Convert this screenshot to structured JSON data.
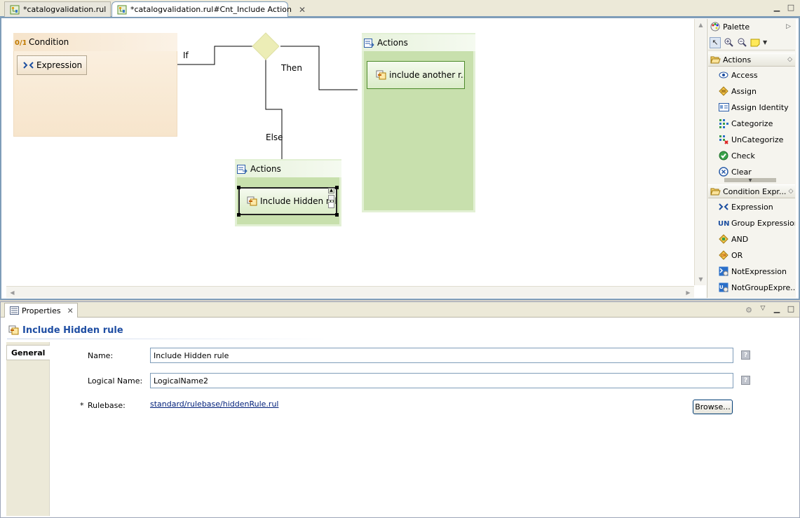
{
  "editor_tabs": [
    {
      "label": "*catalogvalidation.rul",
      "active": false
    },
    {
      "label": "*catalogvalidation.rul#Cnt_Include Action",
      "active": true
    }
  ],
  "diagram": {
    "condition": {
      "title": "Condition",
      "expression_label": "Expression"
    },
    "connector_labels": {
      "if": "If",
      "then": "Then",
      "else": "Else"
    },
    "actions_then": {
      "title": "Actions",
      "item_label": "include another r..."
    },
    "actions_else": {
      "title": "Actions",
      "item_label": "Include Hidden rul"
    }
  },
  "palette": {
    "title": "Palette",
    "drawers": [
      {
        "label": "Actions",
        "items": [
          {
            "label": "Access",
            "icon": "eye-icon"
          },
          {
            "label": "Assign",
            "icon": "assign-icon"
          },
          {
            "label": "Assign Identity",
            "icon": "identity-card-icon"
          },
          {
            "label": "Categorize",
            "icon": "categorize-grid-icon"
          },
          {
            "label": "UnCategorize",
            "icon": "uncategorize-grid-icon"
          },
          {
            "label": "Check",
            "icon": "check-icon"
          },
          {
            "label": "Clear",
            "icon": "clear-icon"
          }
        ]
      },
      {
        "label": "Condition Expr...",
        "items": [
          {
            "label": "Expression",
            "icon": "expression-icon"
          },
          {
            "label": "Group Expression",
            "icon": "group-expression-icon"
          },
          {
            "label": "AND",
            "icon": "and-icon"
          },
          {
            "label": "OR",
            "icon": "or-icon"
          },
          {
            "label": "NotExpression",
            "icon": "not-expression-icon"
          },
          {
            "label": "NotGroupExpre...",
            "icon": "not-group-expression-icon"
          }
        ]
      }
    ]
  },
  "properties": {
    "tab_label": "Properties",
    "title": "Include Hidden rule",
    "section_tab": "General",
    "fields": {
      "name": {
        "label": "Name:",
        "value": "Include Hidden rule"
      },
      "logical_name": {
        "label": "Logical Name:",
        "value": "LogicalName2"
      },
      "rulebase": {
        "required_mark": "*",
        "label": "Rulebase:",
        "value": "standard/rulebase/hiddenRule.rul",
        "browse_label": "Browse..."
      }
    },
    "help_symbol": "?"
  },
  "colors": {
    "condition_fill": "#f7e5cc",
    "actions_fill": "#c8e0ad",
    "selection_border": "#4d8a2b",
    "title_blue": "#1f4ea3",
    "frame_blue": "#7f9db9"
  }
}
